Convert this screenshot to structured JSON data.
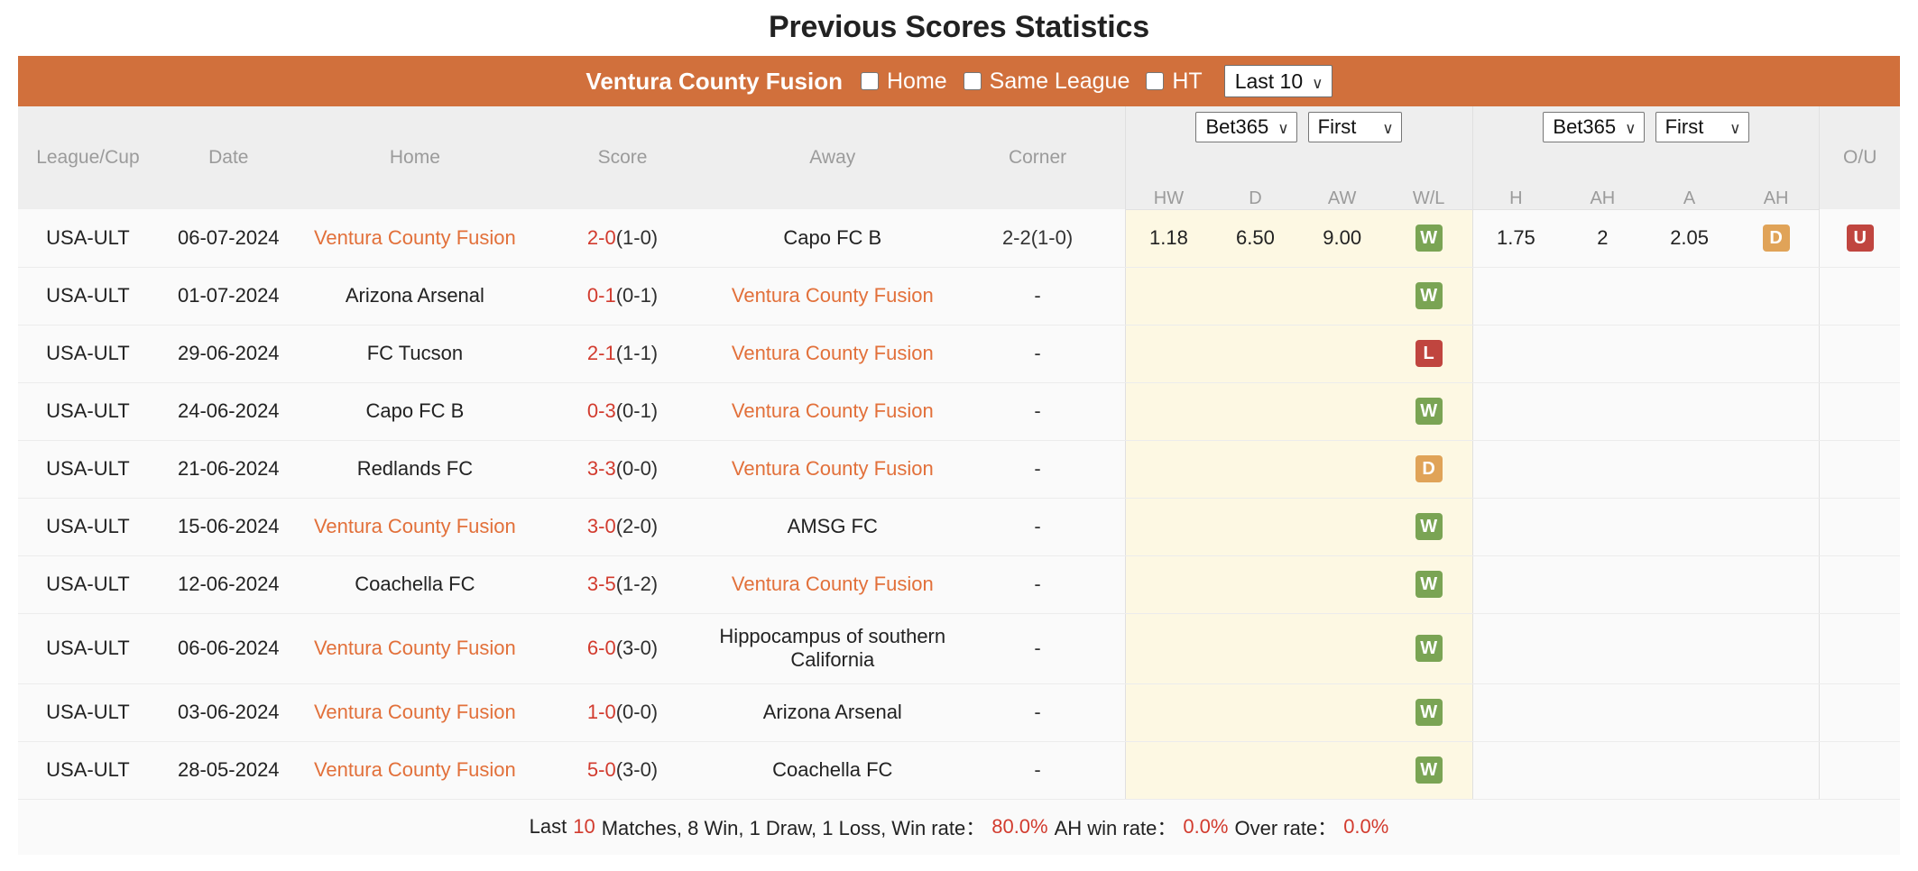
{
  "page": {
    "title": "Previous Scores Statistics"
  },
  "filter_bar": {
    "team": "Ventura County Fusion",
    "checkboxes": [
      {
        "label": "Home",
        "checked": false
      },
      {
        "label": "Same League",
        "checked": false
      },
      {
        "label": "HT",
        "checked": false
      }
    ],
    "range_select": {
      "value": "Last 10",
      "icon": "chevron-down-icon"
    }
  },
  "table": {
    "headers": {
      "league": "League/Cup",
      "date": "Date",
      "home": "Home",
      "score": "Score",
      "away": "Away",
      "corner": "Corner",
      "ou": "O/U"
    },
    "odds_group": {
      "bookmaker_select": "Bet365",
      "period_select": "First",
      "sub": [
        "HW",
        "D",
        "AW",
        "W/L"
      ]
    },
    "ah_group": {
      "bookmaker_select": "Bet365",
      "period_select": "First",
      "sub": [
        "H",
        "AH",
        "A",
        "AH"
      ]
    },
    "rows": [
      {
        "league": "USA-ULT",
        "date": "06-07-2024",
        "home": "Ventura County Fusion",
        "home_highlight": true,
        "score_main": "2-0",
        "score_ht": "(1-0)",
        "away": "Capo FC B",
        "away_highlight": false,
        "corner": "2-2(1-0)",
        "hw": "1.18",
        "d": "6.50",
        "aw": "9.00",
        "wl": "W",
        "wl_type": "w",
        "h": "1.75",
        "ah1": "2",
        "a": "2.05",
        "ah2": "D",
        "ah2_type": "d",
        "ou": "U",
        "ou_type": "u"
      },
      {
        "league": "USA-ULT",
        "date": "01-07-2024",
        "home": "Arizona Arsenal",
        "home_highlight": false,
        "score_main": "0-1",
        "score_ht": "(0-1)",
        "away": "Ventura County Fusion",
        "away_highlight": true,
        "corner": "-",
        "hw": "",
        "d": "",
        "aw": "",
        "wl": "W",
        "wl_type": "w",
        "h": "",
        "ah1": "",
        "a": "",
        "ah2": "",
        "ah2_type": "",
        "ou": "",
        "ou_type": ""
      },
      {
        "league": "USA-ULT",
        "date": "29-06-2024",
        "home": "FC Tucson",
        "home_highlight": false,
        "score_main": "2-1",
        "score_ht": "(1-1)",
        "away": "Ventura County Fusion",
        "away_highlight": true,
        "corner": "-",
        "hw": "",
        "d": "",
        "aw": "",
        "wl": "L",
        "wl_type": "l",
        "h": "",
        "ah1": "",
        "a": "",
        "ah2": "",
        "ah2_type": "",
        "ou": "",
        "ou_type": ""
      },
      {
        "league": "USA-ULT",
        "date": "24-06-2024",
        "home": "Capo FC B",
        "home_highlight": false,
        "score_main": "0-3",
        "score_ht": "(0-1)",
        "away": "Ventura County Fusion",
        "away_highlight": true,
        "corner": "-",
        "hw": "",
        "d": "",
        "aw": "",
        "wl": "W",
        "wl_type": "w",
        "h": "",
        "ah1": "",
        "a": "",
        "ah2": "",
        "ah2_type": "",
        "ou": "",
        "ou_type": ""
      },
      {
        "league": "USA-ULT",
        "date": "21-06-2024",
        "home": "Redlands FC",
        "home_highlight": false,
        "score_main": "3-3",
        "score_ht": "(0-0)",
        "away": "Ventura County Fusion",
        "away_highlight": true,
        "corner": "-",
        "hw": "",
        "d": "",
        "aw": "",
        "wl": "D",
        "wl_type": "d",
        "h": "",
        "ah1": "",
        "a": "",
        "ah2": "",
        "ah2_type": "",
        "ou": "",
        "ou_type": ""
      },
      {
        "league": "USA-ULT",
        "date": "15-06-2024",
        "home": "Ventura County Fusion",
        "home_highlight": true,
        "score_main": "3-0",
        "score_ht": "(2-0)",
        "away": "AMSG FC",
        "away_highlight": false,
        "corner": "-",
        "hw": "",
        "d": "",
        "aw": "",
        "wl": "W",
        "wl_type": "w",
        "h": "",
        "ah1": "",
        "a": "",
        "ah2": "",
        "ah2_type": "",
        "ou": "",
        "ou_type": ""
      },
      {
        "league": "USA-ULT",
        "date": "12-06-2024",
        "home": "Coachella FC",
        "home_highlight": false,
        "score_main": "3-5",
        "score_ht": "(1-2)",
        "away": "Ventura County Fusion",
        "away_highlight": true,
        "corner": "-",
        "hw": "",
        "d": "",
        "aw": "",
        "wl": "W",
        "wl_type": "w",
        "h": "",
        "ah1": "",
        "a": "",
        "ah2": "",
        "ah2_type": "",
        "ou": "",
        "ou_type": ""
      },
      {
        "league": "USA-ULT",
        "date": "06-06-2024",
        "home": "Ventura County Fusion",
        "home_highlight": true,
        "score_main": "6-0",
        "score_ht": "(3-0)",
        "away": "Hippocampus of southern California",
        "away_highlight": false,
        "corner": "-",
        "hw": "",
        "d": "",
        "aw": "",
        "wl": "W",
        "wl_type": "w",
        "h": "",
        "ah1": "",
        "a": "",
        "ah2": "",
        "ah2_type": "",
        "ou": "",
        "ou_type": "",
        "tall": true
      },
      {
        "league": "USA-ULT",
        "date": "03-06-2024",
        "home": "Ventura County Fusion",
        "home_highlight": true,
        "score_main": "1-0",
        "score_ht": "(0-0)",
        "away": "Arizona Arsenal",
        "away_highlight": false,
        "corner": "-",
        "hw": "",
        "d": "",
        "aw": "",
        "wl": "W",
        "wl_type": "w",
        "h": "",
        "ah1": "",
        "a": "",
        "ah2": "",
        "ah2_type": "",
        "ou": "",
        "ou_type": ""
      },
      {
        "league": "USA-ULT",
        "date": "28-05-2024",
        "home": "Ventura County Fusion",
        "home_highlight": true,
        "score_main": "5-0",
        "score_ht": "(3-0)",
        "away": "Coachella FC",
        "away_highlight": false,
        "corner": "-",
        "hw": "",
        "d": "",
        "aw": "",
        "wl": "W",
        "wl_type": "w",
        "h": "",
        "ah1": "",
        "a": "",
        "ah2": "",
        "ah2_type": "",
        "ou": "",
        "ou_type": ""
      }
    ]
  },
  "summary": {
    "prefix": "Last",
    "count": "10",
    "matches_text": "Matches, 8 Win, 1 Draw, 1 Loss, Win rate：",
    "win_rate": "80.0%",
    "ah_label": "AH win rate：",
    "ah_rate": "0.0%",
    "over_label": "Over rate：",
    "over_rate": "0.0%"
  },
  "colors": {
    "accent_orange": "#d1703c",
    "team_link": "#e2703a",
    "score_red": "#d23b2e",
    "win_green": "#7aa454",
    "loss_red": "#c0453f",
    "draw_orange": "#e0a358",
    "odds_bg": "#fdf8e3"
  }
}
